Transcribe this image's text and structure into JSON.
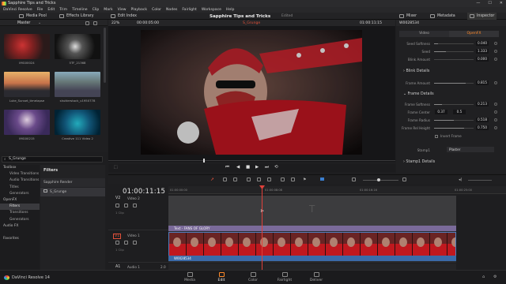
{
  "window": {
    "title": "Sapphire Tips and Tricks",
    "controls": [
      "—",
      "☐",
      "✕"
    ]
  },
  "menu": [
    "DaVinci Resolve",
    "File",
    "Edit",
    "Trim",
    "Timeline",
    "Clip",
    "Mark",
    "View",
    "Playback",
    "Color",
    "Nodes",
    "Fairlight",
    "Workspace",
    "Help"
  ],
  "toolbar": {
    "media_pool": "Media Pool",
    "effects_library": "Effects Library",
    "edit_index": "Edit Index",
    "project_title": "Sapphire Tips and Tricks",
    "project_status": "Edited",
    "mixer": "Mixer",
    "metadata": "Metadata",
    "inspector": "Inspector"
  },
  "media_pool": {
    "bin": "Master",
    "clips": [
      {
        "label": "IMG00024"
      },
      {
        "label": "5TF_21368"
      },
      {
        "label": "Luke_Sunset_timelapse"
      },
      {
        "label": "shutterstock_v1950778"
      },
      {
        "label": "IMG00215"
      },
      {
        "label": "Creative 111 Video 2"
      }
    ]
  },
  "effects": {
    "search_value": "S_Grunge",
    "tree": [
      {
        "label": "Toolbox",
        "hdr": true
      },
      {
        "label": "Video Transitions"
      },
      {
        "label": "Audio Transitions"
      },
      {
        "label": "Titles"
      },
      {
        "label": "Generators"
      },
      {
        "label": "OpenFX",
        "hdr": true
      },
      {
        "label": "Filters",
        "selected": true
      },
      {
        "label": "Transitions"
      },
      {
        "label": "Generators"
      },
      {
        "label": "Audio FX",
        "hdr": true
      },
      {
        "label": ""
      },
      {
        "label": "Favorites",
        "hdr": true
      }
    ],
    "list_header": "Filters",
    "list_group": "Sapphire Render",
    "list_item": "S_Grunge"
  },
  "viewer": {
    "zoom": "22%",
    "timecode_left": "00:00:05:00",
    "clip_name": "S_Grunge",
    "timecode_right": "01:00:11:15",
    "transport": [
      "⏮",
      "◀",
      "■",
      "▶",
      "⏭",
      "⟲"
    ]
  },
  "inspector": {
    "clip_id": "W0028534",
    "tabs": [
      "Video",
      "OpenFX"
    ],
    "active_tab": "OpenFX",
    "props": [
      {
        "label": "Seed Softness",
        "value": "0.040",
        "fill": 0.1
      },
      {
        "label": "Seed",
        "value": "1.333",
        "fill": 0.3
      },
      {
        "label": "Blink Amount",
        "value": "0.000",
        "fill": 0.0
      }
    ],
    "section_blink": "Blink Details",
    "blink_props": [
      {
        "label": "Frame Amount",
        "value": "0.815",
        "fill": 0.8
      }
    ],
    "section_frame": "Frame Details",
    "frame_props": [
      {
        "label": "Frame Softness",
        "value": "0.213",
        "fill": 0.2
      },
      {
        "label": "Frame Radius",
        "value": "0.518",
        "fill": 0.5
      },
      {
        "label": "Frame Rel Height",
        "value": "0.750",
        "fill": 0.75
      }
    ],
    "frame_center_label": "Frame Center",
    "frame_center_x": "0.37",
    "frame_center_y": "0.5",
    "invert_frame": "Invert Frame",
    "stamp_label": "Stamp1",
    "stamp_value": "Plaster",
    "section_stamp": "Stamp1 Details"
  },
  "timeline": {
    "timecode": "01:00:11:15",
    "ruler_marks": [
      "01:00:00:00",
      "01:00:08:08",
      "01:00:16:16",
      "01:00:25:00"
    ],
    "tracks": {
      "v2": {
        "id": "V2",
        "name": "Video 2",
        "clips": "1 Clip"
      },
      "v1": {
        "id": "V1",
        "name": "Video 1",
        "clips": "1 Clip"
      },
      "a1": {
        "id": "A1",
        "name": "Audio 1",
        "level": "2.0"
      }
    },
    "title_clip": "Text - FANS OF GLORY",
    "video_clip": "W0028534"
  },
  "bottom": {
    "app": "DaVinci Resolve 14",
    "pages": [
      "Media",
      "Edit",
      "Color",
      "Fairlight",
      "Deliver"
    ],
    "active_page": "Edit"
  }
}
